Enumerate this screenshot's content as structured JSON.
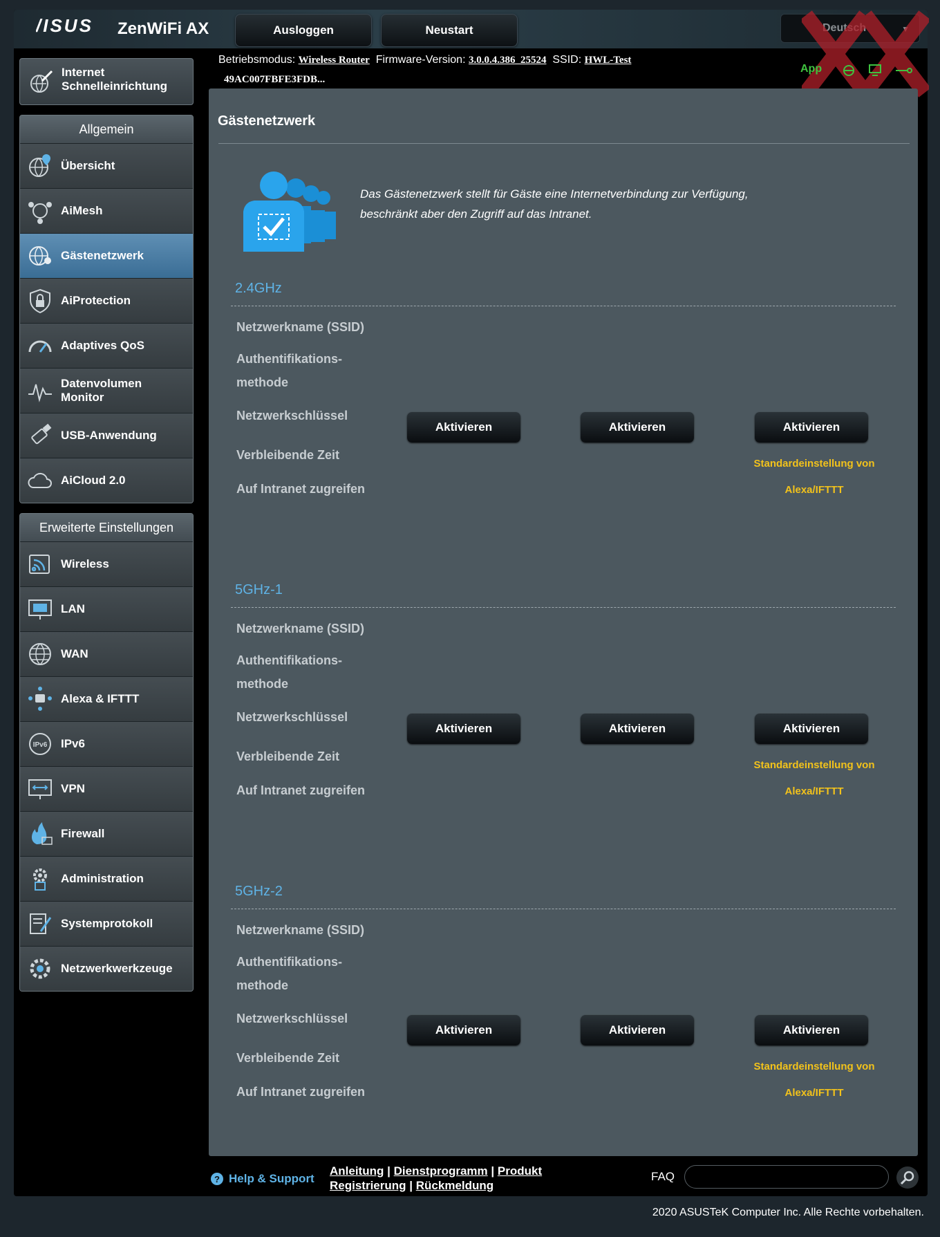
{
  "header": {
    "logo": "/ISUS",
    "product": "ZenWiFi AX",
    "logout_label": "Ausloggen",
    "reboot_label": "Neustart",
    "language": "Deutsch"
  },
  "status": {
    "mode_label": "Betriebsmodus:",
    "mode_value": "Wireless Router",
    "firmware_label": "Firmware-Version:",
    "firmware_value": "3.0.0.4.386_25524",
    "ssid_label": "SSID:",
    "ssid_value": "HWL-Test",
    "ssid2_value": "49AC007FBFE3FDB...",
    "app_label": "App"
  },
  "sidebar": {
    "qis_label_line1": "Internet",
    "qis_label_line2": "Schnelleinrichtung",
    "general_title": "Allgemein",
    "general_items": [
      {
        "label": "Übersicht",
        "icon": "globe-map-icon"
      },
      {
        "label": "AiMesh",
        "icon": "mesh-icon"
      },
      {
        "label": "Gästenetzwerk",
        "icon": "guest-globe-icon"
      },
      {
        "label": "AiProtection",
        "icon": "shield-lock-icon"
      },
      {
        "label": "Adaptives QoS",
        "icon": "speedometer-icon"
      },
      {
        "label": "Datenvolumen",
        "label2": "Monitor",
        "icon": "traffic-monitor-icon"
      },
      {
        "label": "USB-Anwendung",
        "icon": "usb-icon"
      },
      {
        "label": "AiCloud 2.0",
        "icon": "cloud-icon"
      }
    ],
    "advanced_title": "Erweiterte Einstellungen",
    "advanced_items": [
      {
        "label": "Wireless",
        "icon": "wireless-icon"
      },
      {
        "label": "LAN",
        "icon": "lan-icon"
      },
      {
        "label": "WAN",
        "icon": "wan-globe-icon"
      },
      {
        "label": "Alexa & IFTTT",
        "icon": "alexa-icon"
      },
      {
        "label": "IPv6",
        "icon": "ipv6-icon"
      },
      {
        "label": "VPN",
        "icon": "vpn-icon"
      },
      {
        "label": "Firewall",
        "icon": "firewall-icon"
      },
      {
        "label": "Administration",
        "icon": "admin-gear-icon"
      },
      {
        "label": "Systemprotokoll",
        "icon": "system-log-icon"
      },
      {
        "label": "Netzwerkwerkzeuge",
        "icon": "network-tools-icon"
      }
    ]
  },
  "main": {
    "title": "Gästenetzwerk",
    "description_line1": "Das Gästenetzwerk stellt für Gäste eine Internetverbindung zur Verfügung,",
    "description_line2": "beschränkt aber den Zugriff auf das Intranet.",
    "bands": [
      {
        "title": "2.4GHz",
        "fields": [
          "Netzwerkname (SSID)",
          "Authentifikations-",
          "methode",
          "Netzwerkschlüssel",
          "Verbleibende Zeit",
          "Auf Intranet zugreifen"
        ],
        "buttons": [
          "Aktivieren",
          "Aktivieren",
          "Aktivieren"
        ],
        "note_line1": "Standardeinstellung von",
        "note_line2": "Alexa/IFTTT"
      },
      {
        "title": "5GHz-1",
        "fields": [
          "Netzwerkname (SSID)",
          "Authentifikations-",
          "methode",
          "Netzwerkschlüssel",
          "Verbleibende Zeit",
          "Auf Intranet zugreifen"
        ],
        "buttons": [
          "Aktivieren",
          "Aktivieren",
          "Aktivieren"
        ],
        "note_line1": "Standardeinstellung von",
        "note_line2": "Alexa/IFTTT"
      },
      {
        "title": "5GHz-2",
        "fields": [
          "Netzwerkname (SSID)",
          "Authentifikations-",
          "methode",
          "Netzwerkschlüssel",
          "Verbleibende Zeit",
          "Auf Intranet zugreifen"
        ],
        "buttons": [
          "Aktivieren",
          "Aktivieren",
          "Aktivieren"
        ],
        "note_line1": "Standardeinstellung von",
        "note_line2": "Alexa/IFTTT"
      }
    ]
  },
  "footer": {
    "help_label": "Help & Support",
    "link_manual": "Anleitung",
    "link_utility": "Dienstprogramm",
    "link_product": "Produkt",
    "link_registration": "Registrierung",
    "link_feedback": "Rückmeldung",
    "sep": "|",
    "faq_label": "FAQ",
    "faq_placeholder": "",
    "copyright": "2020 ASUSTeK Computer Inc. Alle Rechte vorbehalten."
  },
  "colors": {
    "accent_blue": "#5fb3e6",
    "active_nav": "#3a6d95",
    "note_yellow": "#f2c21b",
    "app_green": "#3fc23f"
  }
}
